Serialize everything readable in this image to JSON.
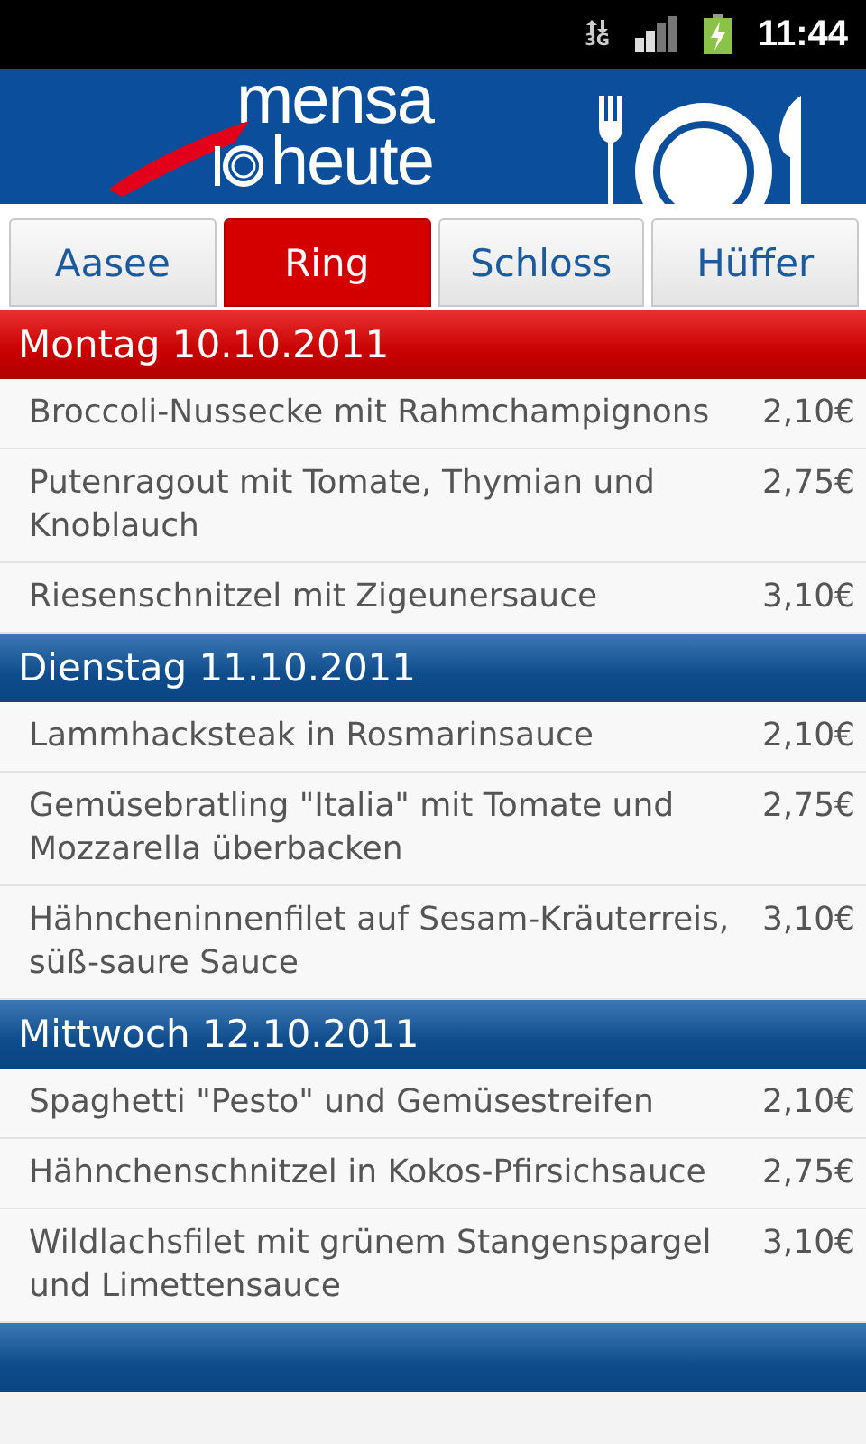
{
  "status_bar": {
    "network": "3G",
    "time": "11:44"
  },
  "header": {
    "logo_top": "mensa",
    "logo_bottom": "heute"
  },
  "tabs": [
    {
      "label": "Aasee",
      "selected": false
    },
    {
      "label": "Ring",
      "selected": true
    },
    {
      "label": "Schloss",
      "selected": false
    },
    {
      "label": "Hüffer",
      "selected": false
    }
  ],
  "days": [
    {
      "kind": "day",
      "title": "Montag 10.10.2011",
      "highlighted": true,
      "dishes": [
        {
          "name": "Broccoli-Nussecke mit Rahmchampignons",
          "price": "2,10€"
        },
        {
          "name": "Putenragout mit Tomate, Thymian und Knoblauch",
          "price": "2,75€"
        },
        {
          "name": "Riesenschnitzel mit Zigeunersauce",
          "price": "3,10€"
        }
      ]
    },
    {
      "kind": "day",
      "title": "Dienstag 11.10.2011",
      "highlighted": false,
      "dishes": [
        {
          "name": "Lammhacksteak in Rosmarinsauce",
          "price": "2,10€"
        },
        {
          "name": "Gemüsebratling \"Italia\" mit Tomate und Mozzarella überbacken",
          "price": "2,75€"
        },
        {
          "name": "Hähncheninnenfilet auf Sesam-Kräuterreis, süß-saure Sauce",
          "price": "3,10€"
        }
      ]
    },
    {
      "kind": "day",
      "title": "Mittwoch 12.10.2011",
      "highlighted": false,
      "dishes": [
        {
          "name": "Spaghetti \"Pesto\" und Gemüsestreifen",
          "price": "2,10€"
        },
        {
          "name": "Hähnchenschnitzel in Kokos-Pfirsichsauce",
          "price": "2,75€"
        },
        {
          "name": "Wildlachsfilet mit grünem Stangenspargel und Limettensauce",
          "price": "3,10€"
        }
      ]
    },
    {
      "kind": "cut",
      "highlighted": false
    }
  ]
}
